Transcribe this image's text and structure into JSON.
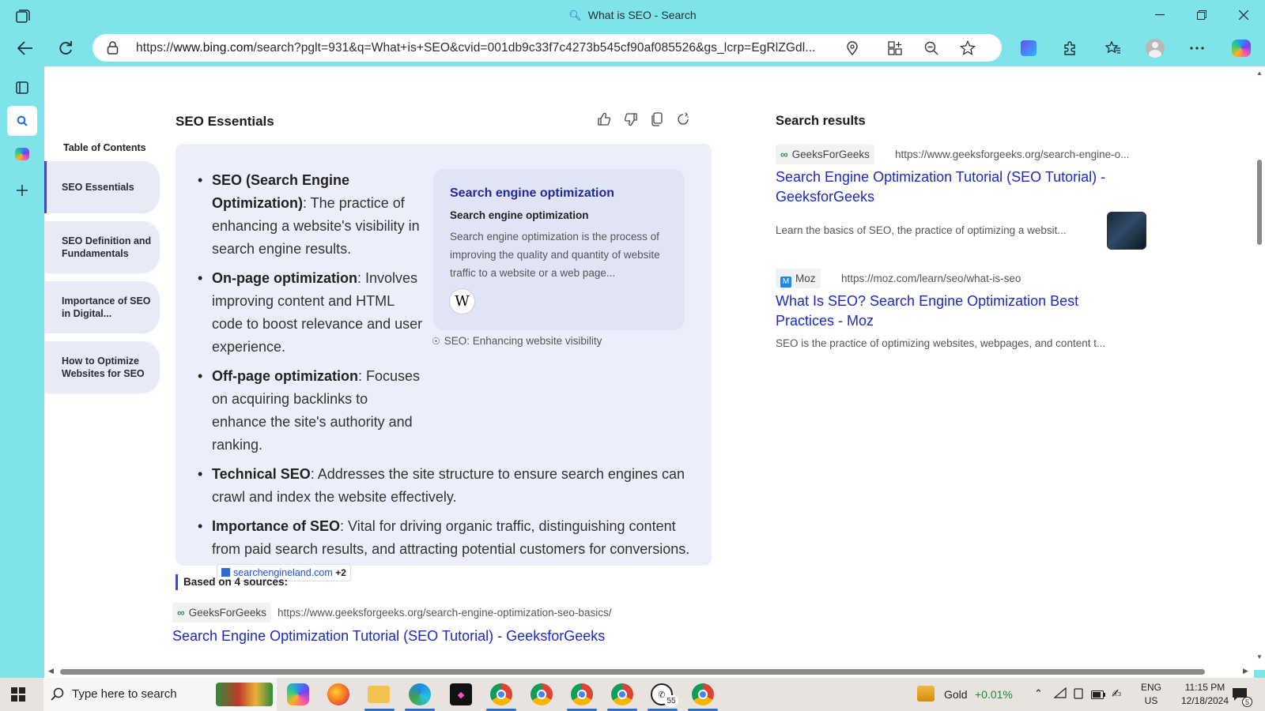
{
  "window": {
    "title": "What is SEO - Search"
  },
  "address_bar": {
    "url_prefix": "https://",
    "url_domain": "www.bing.com",
    "url_rest": "/search?pglt=931&q=What+is+SEO&cvid=001db9c33f7c4273b545cf90af085526&gs_lcrp=EgRlZGdl..."
  },
  "toc": {
    "title": "Table of Contents",
    "items": [
      "SEO Essentials",
      "SEO Definition and Fundamentals",
      "Importance of SEO in Digital...",
      "How to Optimize Websites for SEO"
    ]
  },
  "answer": {
    "title": "SEO Essentials",
    "bullets": [
      {
        "key": "SEO (Search Engine Optimization)",
        "text": ": The practice of enhancing a website's visibility in search engine results."
      },
      {
        "key": "On-page optimization",
        "text": ": Involves improving content and HTML code to boost relevance and user experience."
      },
      {
        "key": "Off-page optimization",
        "text": ": Focuses on acquiring backlinks to enhance the site's authority and ranking."
      },
      {
        "key": "Technical SEO",
        "text": ": Addresses the site structure to ensure search engines can crawl and index the website effectively."
      },
      {
        "key": "Importance of SEO",
        "text": ": Vital for driving organic traffic, distinguishing content from paid search results, and attracting potential customers for conversions."
      }
    ],
    "source_chip": {
      "label": "searchengineland.com",
      "more": "+2"
    },
    "wiki_card": {
      "heading": "Search engine optimization",
      "subheading": "Search engine optimization",
      "description": "Search engine optimization is the process of improving the quality and quantity of website traffic to a website or a web page...",
      "logo": "W",
      "caption": "SEO: Enhancing website visibility"
    },
    "based_on": "Based on 4 sources:",
    "source1": {
      "site": "GeeksForGeeks",
      "url": "https://www.geeksforgeeks.org/search-engine-optimization-seo-basics/",
      "title": "Search Engine Optimization Tutorial (SEO Tutorial) - GeeksforGeeks"
    }
  },
  "search_results": {
    "title": "Search results",
    "items": [
      {
        "site": "GeeksForGeeks",
        "url": "https://www.geeksforgeeks.org/search-engine-o...",
        "title_line1": "Search Engine Optimization Tutorial (SEO Tutorial) -",
        "title_line2": "GeeksforGeeks",
        "desc": "Learn the basics of SEO, the practice of optimizing a websit..."
      },
      {
        "site": "Moz",
        "url": "https://moz.com/learn/seo/what-is-seo",
        "title_line1": "What Is SEO? Search Engine Optimization Best",
        "title_line2": "Practices - Moz",
        "desc": "SEO is the practice of optimizing websites, webpages, and content t..."
      }
    ]
  },
  "taskbar": {
    "search_placeholder": "Type here to search",
    "whatsapp_badge": "55",
    "stock_name": "Gold",
    "stock_change": "+0.01%",
    "lang": "ENG",
    "region": "US",
    "time": "11:15 PM",
    "date": "12/18/2024",
    "notif_count": "5"
  },
  "colors": {
    "chrome": "#7fe3ea",
    "link": "#1a28c8",
    "card": "#eceefb",
    "accent": "#3b4cb8"
  }
}
